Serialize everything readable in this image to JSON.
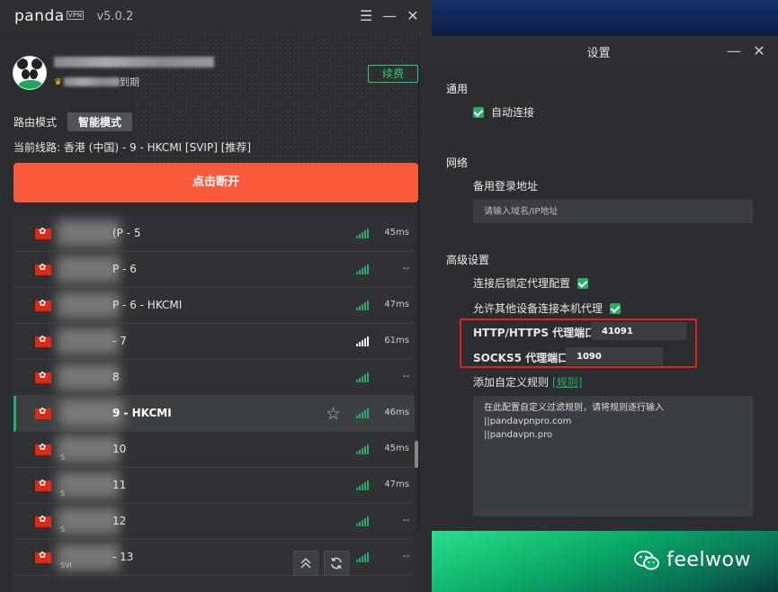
{
  "app": {
    "logo": "panda",
    "logo_badge": "VPN",
    "version": "v5.0.2",
    "expiry_suffix": "到期",
    "renew_label": "续费",
    "route_mode_label": "路由模式",
    "route_mode_value": "智能模式",
    "current_line": "当前线路:  香港 (中国) - 9 - HKCMI [SVIP] [推荐]",
    "connect_label": "点击断开"
  },
  "servers": [
    {
      "name": "(P  - 5",
      "latency": "45ms",
      "active": false,
      "signal": "green"
    },
    {
      "name": "P  - 6",
      "latency": "--",
      "active": false,
      "signal": "green"
    },
    {
      "name": "P  - 6 - HKCMI",
      "latency": "47ms",
      "active": false,
      "signal": "green"
    },
    {
      "name": "- 7",
      "latency": "61ms",
      "active": false,
      "signal": "white"
    },
    {
      "name": "8",
      "latency": "--",
      "active": false,
      "signal": "green"
    },
    {
      "name": "9 - HKCMI",
      "latency": "46ms",
      "active": true,
      "signal": "green"
    },
    {
      "name": "10",
      "latency": "45ms",
      "active": false,
      "signal": "green",
      "sub": "S"
    },
    {
      "name": "11",
      "latency": "47ms",
      "active": false,
      "signal": "green",
      "sub": "S"
    },
    {
      "name": "12",
      "latency": "--",
      "active": false,
      "signal": "green",
      "sub": "S"
    },
    {
      "name": "- 13",
      "latency": "--",
      "active": false,
      "signal": "green",
      "sub": "SVI"
    }
  ],
  "settings": {
    "title": "设置",
    "general": "通用",
    "auto_connect": "自动连接",
    "network": "网络",
    "backup_login": "备用登录地址",
    "backup_placeholder": "请输入域名/IP地址",
    "advanced": "高级设置",
    "lock_proxy": "连接后锁定代理配置",
    "allow_other": "允许其他设备连接本机代理",
    "http_label": "HTTP/HTTPS 代理端口",
    "http_port": "41091",
    "socks_label": "SOCKS5 代理端口",
    "socks_port": "1090",
    "custom_rules": "添加自定义规则",
    "rules_link": "[规则]",
    "rules_hint": "在此配置自定义过滤规则，请将规则逐行输入",
    "rules_lines": [
      "||pandavpnpro.com",
      "||pandavpn.pro"
    ]
  },
  "watermark": "feelwow",
  "colors": {
    "accent_green": "#27ae60",
    "connect_red": "#fb5b3c",
    "highlight_box": "#e32020"
  }
}
